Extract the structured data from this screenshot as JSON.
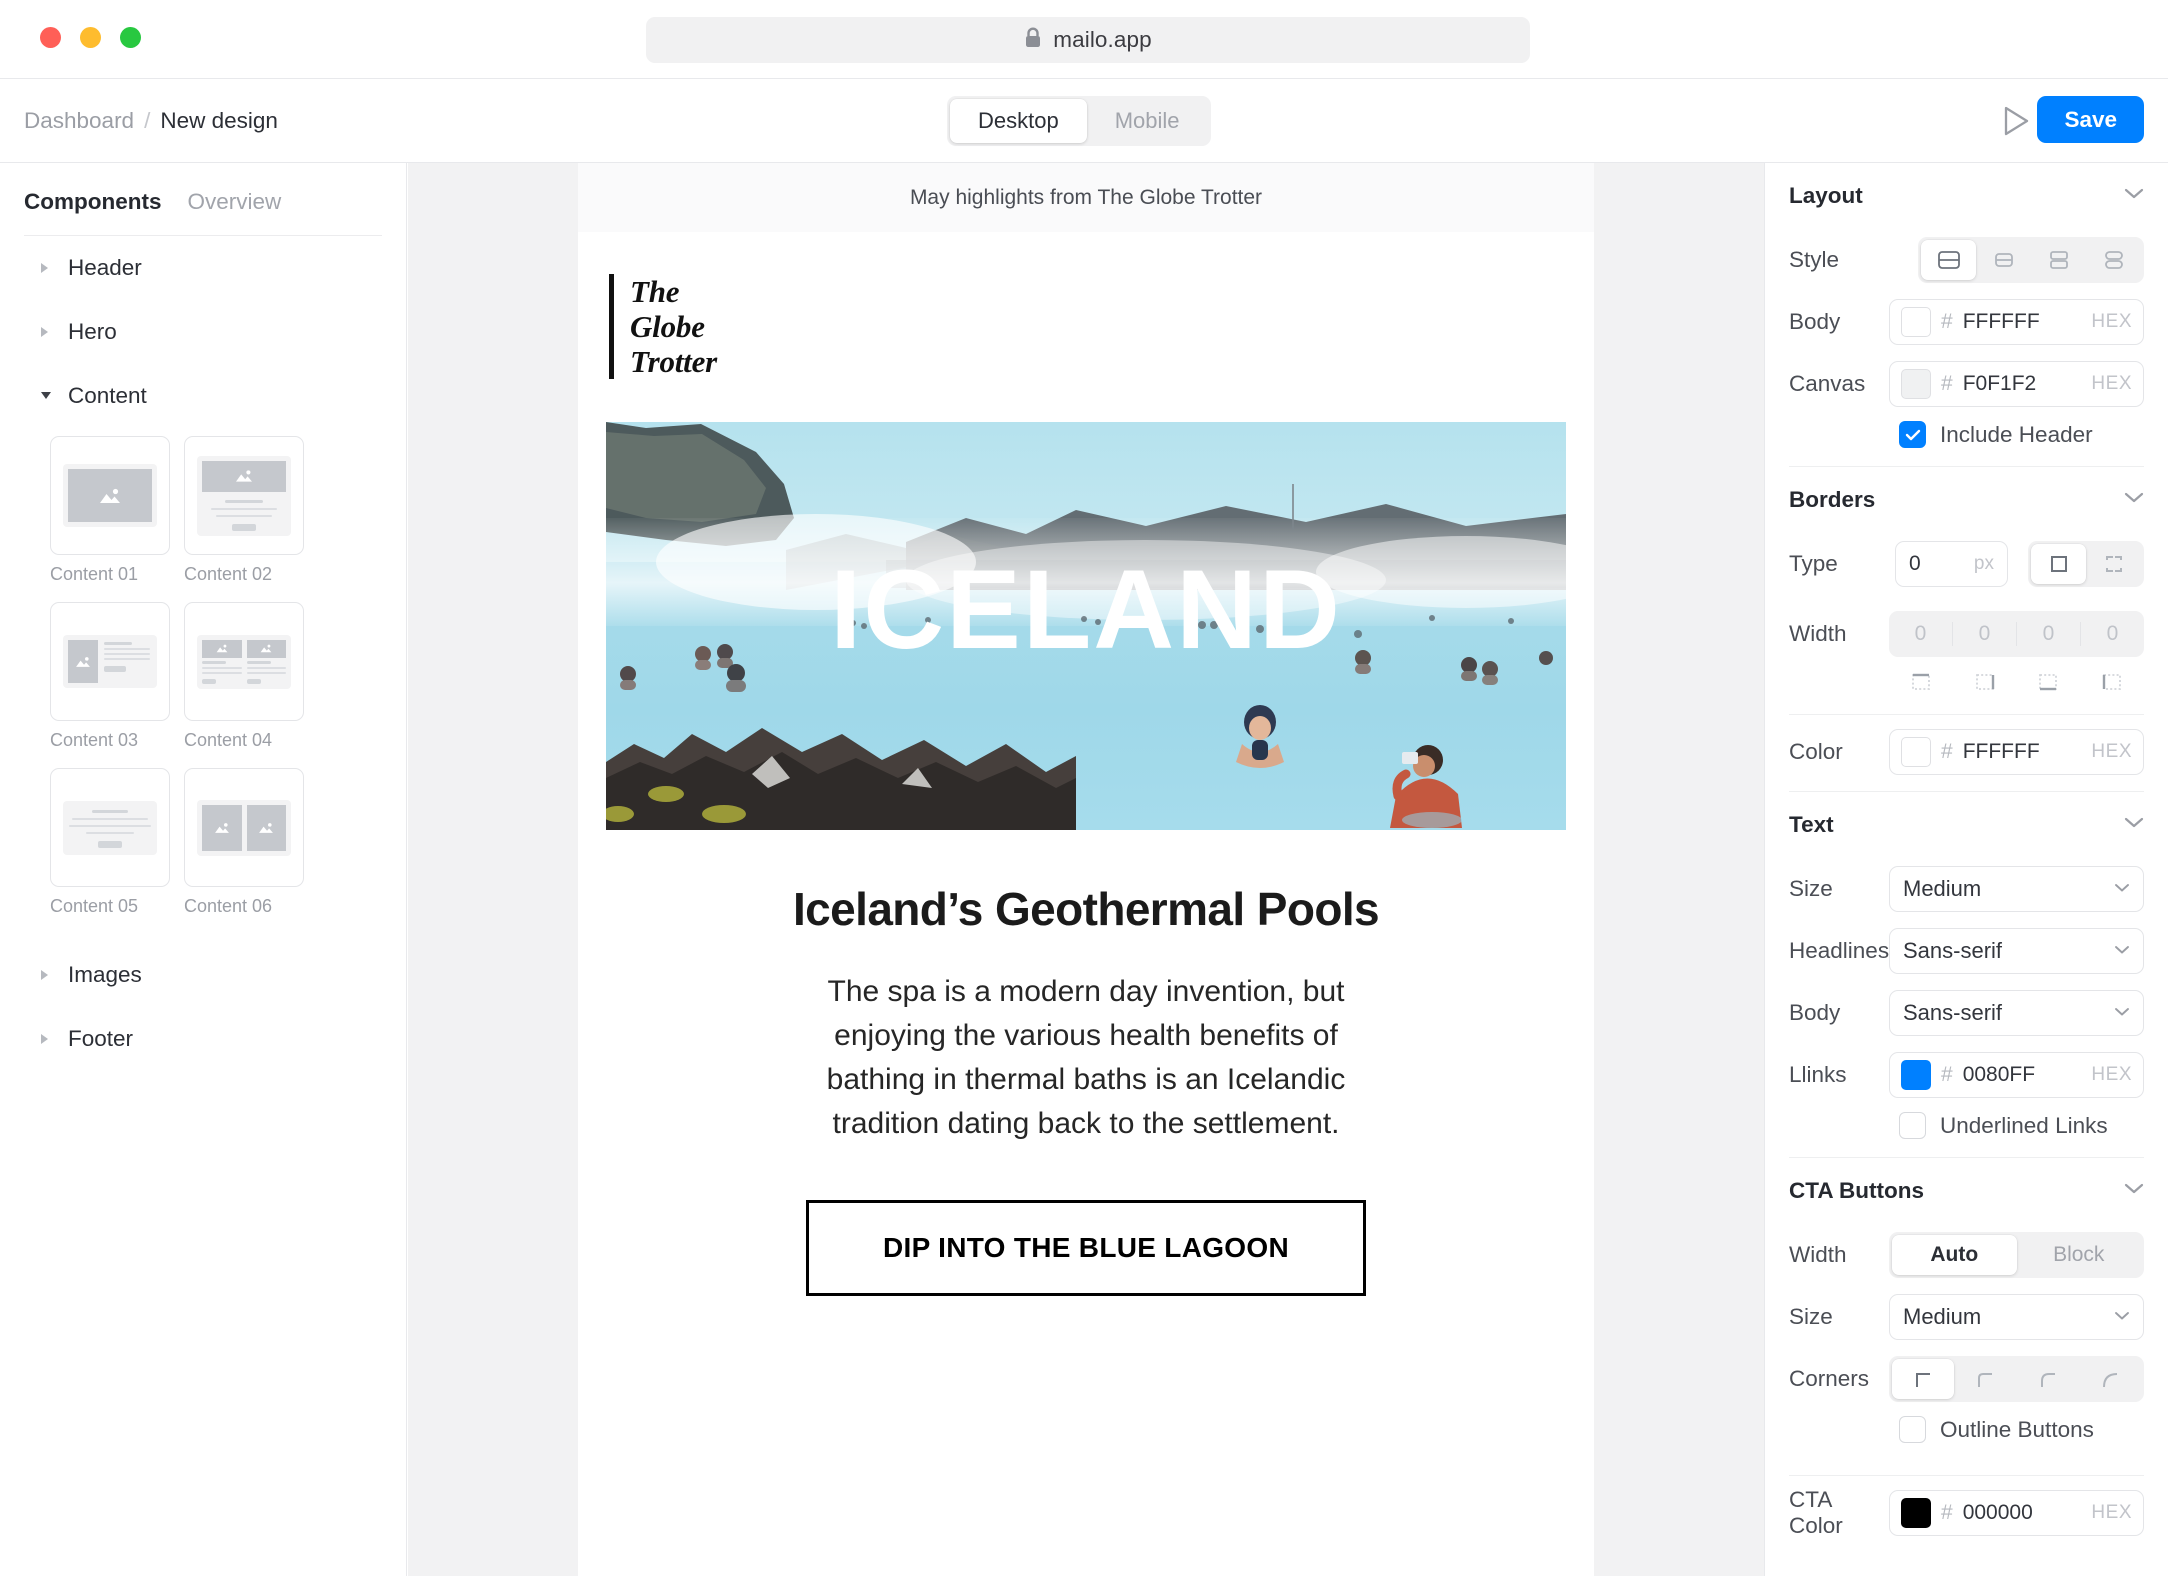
{
  "browser": {
    "url": "mailo.app",
    "lock_icon": "lock-icon",
    "traffic_lights": [
      "close-red",
      "minimize-yellow",
      "maximize-green"
    ]
  },
  "toolbar": {
    "breadcrumb_root": "Dashboard",
    "breadcrumb_sep": "/",
    "breadcrumb_current": "New design",
    "device_tabs": [
      {
        "label": "Desktop",
        "active": true
      },
      {
        "label": "Mobile",
        "active": false
      }
    ],
    "preview_icon": "play-icon",
    "save_label": "Save",
    "save_color": "#0080FF"
  },
  "sidebar": {
    "tabs": [
      {
        "label": "Components",
        "active": true
      },
      {
        "label": "Overview",
        "active": false
      }
    ],
    "groups": [
      {
        "label": "Header",
        "expanded": false
      },
      {
        "label": "Hero",
        "expanded": false
      },
      {
        "label": "Content",
        "expanded": true
      },
      {
        "label": "Images",
        "expanded": false
      },
      {
        "label": "Footer",
        "expanded": false
      }
    ],
    "content_thumbnails": [
      {
        "label": "Content 01",
        "kind": "single-image"
      },
      {
        "label": "Content 02",
        "kind": "image-over-text"
      },
      {
        "label": "Content 03",
        "kind": "image-left-text-right"
      },
      {
        "label": "Content 04",
        "kind": "two-column"
      },
      {
        "label": "Content 05",
        "kind": "text-only"
      },
      {
        "label": "Content 06",
        "kind": "two-images"
      }
    ]
  },
  "email": {
    "preheader": "May highlights from The Globe Trotter",
    "logo_lines": [
      "The",
      "Globe",
      "Trotter"
    ],
    "hero_title": "ICELAND",
    "hero_alt": "Blue Lagoon geothermal pool with bathers",
    "headline": "Iceland’s Geothermal Pools",
    "body": "The spa is a modern day invention, but enjoying the various health benefits of bathing in thermal baths is an Icelandic tradition dating back to the settlement.",
    "cta_label": "DIP INTO THE BLUE LAGOON"
  },
  "inspector": {
    "layout": {
      "title": "Layout",
      "collapse_icon": "chevron-down-icon",
      "style_label": "Style",
      "style_options": [
        "layout-split-large",
        "layout-split-small",
        "layout-stack-two",
        "layout-stack-pill"
      ],
      "style_selected_index": 0,
      "body_label": "Body",
      "body_hex": "FFFFFF",
      "body_swatch": "#FFFFFF",
      "canvas_label": "Canvas",
      "canvas_hex": "F0F1F2",
      "canvas_swatch": "#F0F1F2",
      "hex_hash": "#",
      "hex_unit": "HEX",
      "include_header_label": "Include Header",
      "include_header_checked": true
    },
    "borders": {
      "title": "Borders",
      "collapse_icon": "chevron-down-icon",
      "type_label": "Type",
      "type_value": "0",
      "type_unit": "px",
      "type_options": [
        "border-all",
        "border-dashed-frame"
      ],
      "type_selected_index": 0,
      "width_label": "Width",
      "width_values": [
        "0",
        "0",
        "0",
        "0"
      ],
      "side_icons": [
        "border-top-icon",
        "border-right-icon",
        "border-bottom-icon",
        "border-left-icon"
      ],
      "color_label": "Color",
      "color_hex": "FFFFFF",
      "color_swatch": "#FFFFFF",
      "hex_hash": "#",
      "hex_unit": "HEX"
    },
    "text": {
      "title": "Text",
      "collapse_icon": "chevron-down-icon",
      "size_label": "Size",
      "size_value": "Medium",
      "headlines_label": "Headlines",
      "headlines_value": "Sans-serif",
      "body_label": "Body",
      "body_value": "Sans-serif",
      "links_label": "Llinks",
      "links_hex": "0080FF",
      "links_swatch": "#0080FF",
      "hex_hash": "#",
      "hex_unit": "HEX",
      "underlined_label": "Underlined Links",
      "underlined_checked": false
    },
    "cta": {
      "title": "CTA Buttons",
      "collapse_icon": "chevron-down-icon",
      "width_label": "Width",
      "width_options": [
        {
          "label": "Auto",
          "active": true
        },
        {
          "label": "Block",
          "active": false
        }
      ],
      "size_label": "Size",
      "size_value": "Medium",
      "corners_label": "Corners",
      "corners_options": [
        "corner-square",
        "corner-small",
        "corner-medium",
        "corner-large"
      ],
      "corners_selected_index": 0,
      "outline_label": "Outline Buttons",
      "outline_checked": false,
      "cta_color_label": "CTA Color",
      "cta_color_hex": "000000",
      "cta_color_swatch": "#000000",
      "hex_hash": "#",
      "hex_unit": "HEX"
    }
  }
}
